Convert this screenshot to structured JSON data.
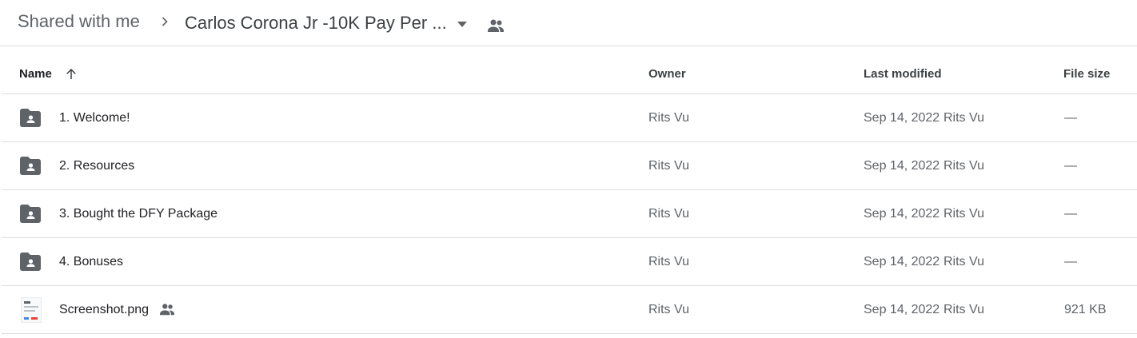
{
  "breadcrumb": {
    "root": "Shared with me",
    "current": "Carlos Corona Jr -10K Pay Per ..."
  },
  "columns": {
    "name": "Name",
    "owner": "Owner",
    "last_modified": "Last modified",
    "file_size": "File size"
  },
  "rows": [
    {
      "name": "1. Welcome!",
      "type": "shared-folder",
      "owner": "Rits Vu",
      "modified_date": "Sep 14, 2022",
      "modified_by": "Rits Vu",
      "size": "—"
    },
    {
      "name": "2. Resources",
      "type": "shared-folder",
      "owner": "Rits Vu",
      "modified_date": "Sep 14, 2022",
      "modified_by": "Rits Vu",
      "size": "—"
    },
    {
      "name": "3. Bought the DFY Package",
      "type": "shared-folder",
      "owner": "Rits Vu",
      "modified_date": "Sep 14, 2022",
      "modified_by": "Rits Vu",
      "size": "—"
    },
    {
      "name": "4. Bonuses",
      "type": "shared-folder",
      "owner": "Rits Vu",
      "modified_date": "Sep 14, 2022",
      "modified_by": "Rits Vu",
      "size": "—"
    },
    {
      "name": "Screenshot.png",
      "type": "image-file",
      "shared": true,
      "owner": "Rits Vu",
      "modified_date": "Sep 14, 2022",
      "modified_by": "Rits Vu",
      "size": "921 KB"
    }
  ],
  "icons": {
    "separator": "chevron-right-icon",
    "dropdown": "arrow-drop-down-icon",
    "shared": "people-icon",
    "sort": "arrow-upward-icon",
    "folder": "shared-folder-icon"
  },
  "colors": {
    "icon_gray": "#5f6368",
    "divider": "#dadce0",
    "text_primary": "#202124"
  }
}
